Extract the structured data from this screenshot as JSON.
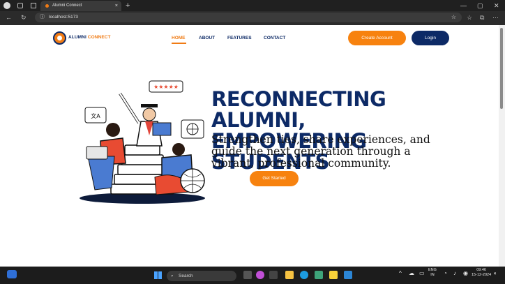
{
  "browser": {
    "tab_title": "Alumni Connect",
    "tab_close": "×",
    "new_tab": "+",
    "address": "localhost:5173",
    "win_min": "—",
    "win_max": "▢",
    "win_close": "✕"
  },
  "nav": {
    "brand_main": "ALUMNI",
    "brand_accent": "CONNECT",
    "items": [
      "HOME",
      "ABOUT",
      "FEATURES",
      "CONTACT"
    ],
    "create_account": "Create Account",
    "login": "Login"
  },
  "hero": {
    "headline_line1": "RECONNECTING ALUMNI,",
    "headline_line2": "EMPOWERING STUDENTS",
    "subtext": "Strengthen ties, share experiences, and guide the next generation through a vibrant, professional community.",
    "cta": "Get Started",
    "rating_stars": "★★★★★",
    "translate_glyph": "文A"
  },
  "taskbar": {
    "search_label": "Search",
    "lang": "ENG",
    "region": "IN",
    "time": "09:46",
    "date": "15-12-2024"
  },
  "colors": {
    "navy": "#0d2a66",
    "orange": "#f7820f"
  }
}
